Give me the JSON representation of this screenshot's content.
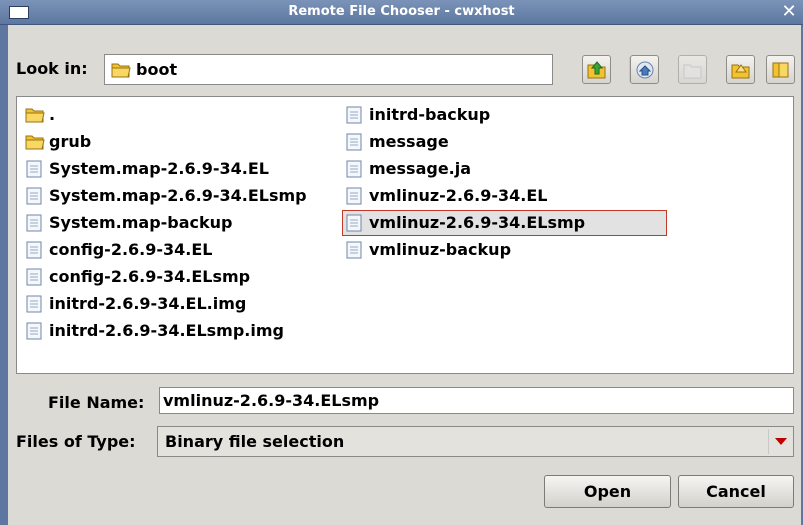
{
  "window": {
    "title": "Remote File Chooser - cwxhost",
    "close_glyph": "✕"
  },
  "look_in": {
    "label": "Look in:",
    "value": "boot",
    "icon": "folder-icon"
  },
  "toolbar": [
    {
      "name": "up-folder-button",
      "icon": "up-folder-icon",
      "enabled": true
    },
    {
      "name": "home-button",
      "icon": "home-icon",
      "enabled": true
    },
    {
      "name": "new-folder-button",
      "icon": "new-folder-icon",
      "enabled": false
    },
    {
      "name": "list-view-button",
      "icon": "list-view-icon",
      "enabled": true
    },
    {
      "name": "details-view-button",
      "icon": "details-view-icon",
      "enabled": true
    }
  ],
  "files": {
    "column1": [
      {
        "name": ".",
        "type": "folder"
      },
      {
        "name": "grub",
        "type": "folder"
      },
      {
        "name": "System.map-2.6.9-34.EL",
        "type": "file"
      },
      {
        "name": "System.map-2.6.9-34.ELsmp",
        "type": "file"
      },
      {
        "name": "System.map-backup",
        "type": "file"
      },
      {
        "name": "config-2.6.9-34.EL",
        "type": "file"
      },
      {
        "name": "config-2.6.9-34.ELsmp",
        "type": "file"
      },
      {
        "name": "initrd-2.6.9-34.EL.img",
        "type": "file"
      },
      {
        "name": "initrd-2.6.9-34.ELsmp.img",
        "type": "file"
      }
    ],
    "column2": [
      {
        "name": "initrd-backup",
        "type": "file"
      },
      {
        "name": "message",
        "type": "file"
      },
      {
        "name": "message.ja",
        "type": "file"
      },
      {
        "name": "vmlinuz-2.6.9-34.EL",
        "type": "file"
      },
      {
        "name": "vmlinuz-2.6.9-34.ELsmp",
        "type": "file",
        "selected": true
      },
      {
        "name": "vmlinuz-backup",
        "type": "file"
      }
    ]
  },
  "file_name": {
    "label": "File Name:",
    "value": "vmlinuz-2.6.9-34.ELsmp"
  },
  "files_of_type": {
    "label": "Files of Type:",
    "value": "Binary file selection"
  },
  "buttons": {
    "open": "Open",
    "cancel": "Cancel"
  },
  "colors": {
    "titlebar": "#5d77a0",
    "selection_border": "#c0392b",
    "dropdown_arrow": "#c00000",
    "folder": "#f2c230"
  }
}
